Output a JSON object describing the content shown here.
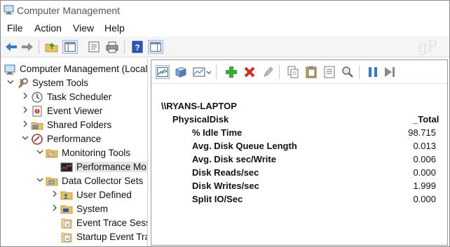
{
  "window": {
    "title": "Computer Management"
  },
  "menu": [
    {
      "label": "File"
    },
    {
      "label": "Action"
    },
    {
      "label": "View"
    },
    {
      "label": "Help"
    }
  ],
  "watermark": {
    "text": "gP"
  },
  "toolbar": {
    "icons": [
      "back-arrow-icon",
      "forward-arrow-icon",
      "up-folder-icon",
      "show-hide-tree-icon",
      "properties-icon",
      "print-icon",
      "help-icon",
      "show-hide-action-pane-icon"
    ]
  },
  "tree": {
    "items": [
      {
        "label": "Computer Management (Local)",
        "icon": "computer-management-icon",
        "expander": "none"
      },
      {
        "label": "System Tools",
        "icon": "system-tools-icon",
        "expander": "expanded"
      },
      {
        "label": "Task Scheduler",
        "icon": "clock-icon",
        "expander": "collapsed"
      },
      {
        "label": "Event Viewer",
        "icon": "event-viewer-icon",
        "expander": "collapsed"
      },
      {
        "label": "Shared Folders",
        "icon": "shared-folder-icon",
        "expander": "collapsed"
      },
      {
        "label": "Performance",
        "icon": "performance-icon",
        "expander": "expanded"
      },
      {
        "label": "Monitoring Tools",
        "icon": "folder-icon",
        "expander": "expanded"
      },
      {
        "label": "Performance Mo",
        "icon": "performance-monitor-icon",
        "expander": "none",
        "selected": true
      },
      {
        "label": "Data Collector Sets",
        "icon": "folder-icon",
        "expander": "expanded"
      },
      {
        "label": "User Defined",
        "icon": "user-folder-icon",
        "expander": "collapsed"
      },
      {
        "label": "System",
        "icon": "system-folder-icon",
        "expander": "collapsed"
      },
      {
        "label": "Event Trace Sessi",
        "icon": "trace-document-icon",
        "expander": "none"
      },
      {
        "label": "Startup Event Tra",
        "icon": "trace-document-icon",
        "expander": "none"
      }
    ]
  },
  "perf_toolbar": {
    "icons": [
      "view-graph-icon",
      "clear-display-icon",
      "change-graph-type-icon",
      "add-counter-icon",
      "delete-counter-icon",
      "highlight-icon",
      "copy-properties-icon",
      "paste-counter-list-icon",
      "properties-icon",
      "zoom-icon",
      "freeze-display-icon",
      "update-data-icon"
    ]
  },
  "report": {
    "machine": "\\\\RYANS-LAPTOP",
    "object": "PhysicalDisk",
    "instance": "_Total",
    "counters": [
      {
        "name": "% Idle Time",
        "value": "98.715"
      },
      {
        "name": "Avg. Disk Queue Length",
        "value": "0.013"
      },
      {
        "name": "Avg. Disk sec/Write",
        "value": "0.006"
      },
      {
        "name": "Disk Reads/sec",
        "value": "0.000"
      },
      {
        "name": "Disk Writes/sec",
        "value": "1.999"
      },
      {
        "name": "Split IO/Sec",
        "value": "0.000"
      }
    ]
  },
  "colors": {
    "selection": "#e5e5e5",
    "add_green": "#3aa935",
    "delete_red": "#d9281f",
    "pause_blue": "#2d7bd1"
  }
}
